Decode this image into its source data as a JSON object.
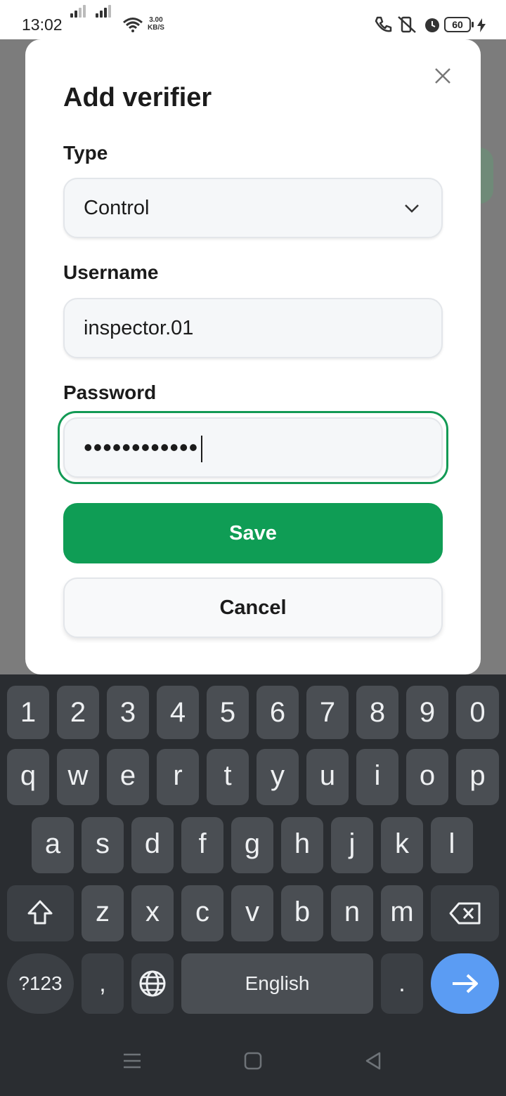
{
  "status_bar": {
    "time": "13:02",
    "speed_value": "3.00",
    "speed_unit": "KB/S",
    "battery": "60"
  },
  "dialog": {
    "title": "Add verifier",
    "type_label": "Type",
    "type_value": "Control",
    "username_label": "Username",
    "username_value": "inspector.01",
    "password_label": "Password",
    "password_value": "••••••••••••",
    "save_label": "Save",
    "cancel_label": "Cancel"
  },
  "keyboard": {
    "numbers": [
      "1",
      "2",
      "3",
      "4",
      "5",
      "6",
      "7",
      "8",
      "9",
      "0"
    ],
    "row1": [
      "q",
      "w",
      "e",
      "r",
      "t",
      "y",
      "u",
      "i",
      "o",
      "p"
    ],
    "row2": [
      "a",
      "s",
      "d",
      "f",
      "g",
      "h",
      "j",
      "k",
      "l"
    ],
    "row3": [
      "z",
      "x",
      "c",
      "v",
      "b",
      "n",
      "m"
    ],
    "symbols_label": "?123",
    "comma": ",",
    "space_label": "English",
    "period": "."
  },
  "colors": {
    "accent_green": "#0f9d55",
    "enter_blue": "#5b9cf3",
    "keyboard_bg": "#2a2d31"
  },
  "icons": [
    "close-icon",
    "chevron-down-icon",
    "shift-icon",
    "backspace-icon",
    "globe-icon",
    "arrow-right-icon",
    "nav-menu-icon",
    "nav-home-icon",
    "nav-back-icon"
  ]
}
